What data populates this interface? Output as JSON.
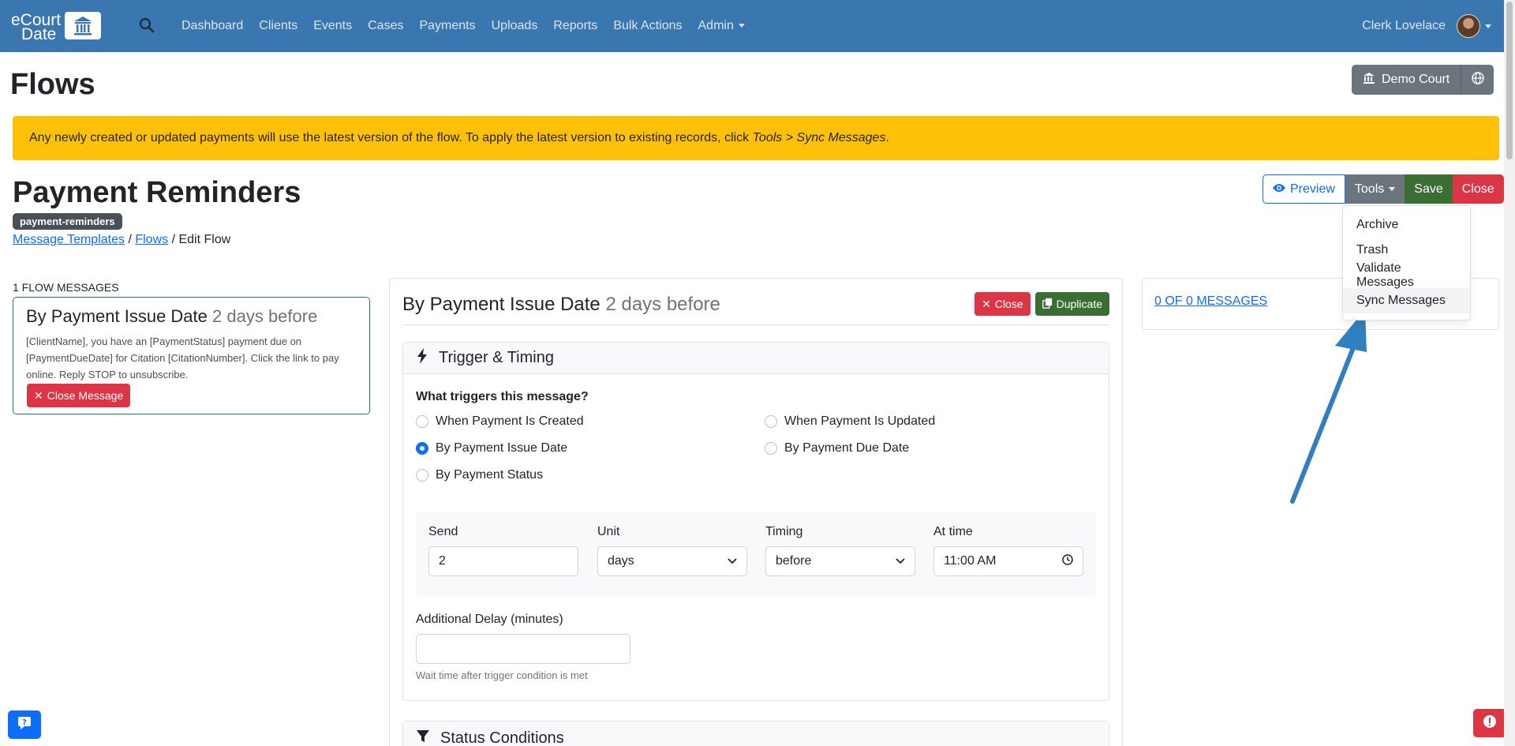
{
  "app": {
    "brand_line1": "eCourt",
    "brand_line2": "Date"
  },
  "nav": {
    "items": [
      "Dashboard",
      "Clients",
      "Events",
      "Cases",
      "Payments",
      "Uploads",
      "Reports",
      "Bulk Actions",
      "Admin"
    ],
    "user_name": "Clerk Lovelace"
  },
  "page": {
    "title": "Flows",
    "court_label": "Demo Court"
  },
  "alert": {
    "text": "Any newly created or updated payments will use the latest version of the flow. To apply the latest version to existing records, click ",
    "emph": "Tools > Sync Messages",
    "end": "."
  },
  "flow": {
    "title": "Payment Reminders",
    "slug": "payment-reminders",
    "breadcrumb": {
      "link1": "Message Templates",
      "sep1": " / ",
      "link2": "Flows",
      "sep2": " / ",
      "current": "Edit Flow"
    }
  },
  "toolbar": {
    "preview": "Preview",
    "tools": "Tools",
    "save": "Save",
    "close": "Close"
  },
  "tools_menu": {
    "items": [
      "Archive",
      "Trash",
      "Validate Messages",
      "Sync Messages"
    ],
    "highlighted": "Sync Messages"
  },
  "messages_list": {
    "count_label": "1 FLOW MESSAGES",
    "card": {
      "title": "By Payment Issue Date",
      "timing": "2 days before",
      "body": "[ClientName], you have an [PaymentStatus] payment due on [PaymentDueDate] for Citation [CitationNumber]. Click the link to pay online. Reply STOP to unsubscribe.",
      "close_label": "Close Message"
    }
  },
  "editor": {
    "title": "By Payment Issue Date",
    "timing": "2 days before",
    "close_label": "Close",
    "duplicate_label": "Duplicate",
    "trigger_section": "Trigger & Timing",
    "trigger_question": "What triggers this message?",
    "trigger_options": [
      "When Payment Is Created",
      "When Payment Is Updated",
      "By Payment Issue Date",
      "By Payment Due Date",
      "By Payment Status"
    ],
    "selected_trigger": "By Payment Issue Date",
    "send_label": "Send",
    "send_value": "2",
    "unit_label": "Unit",
    "unit_value": "days",
    "timing_label": "Timing",
    "timing_value": "before",
    "time_label": "At time",
    "time_value": "11:00 AM",
    "delay_label": "Additional Delay (minutes)",
    "delay_value": "",
    "delay_help": "Wait time after trigger condition is met",
    "status_section": "Status Conditions"
  },
  "right_panel": {
    "messages_link": "0 OF 0 MESSAGES"
  },
  "colors": {
    "navbar": "#3a77b0",
    "alert": "#ffc107",
    "primary": "#0d6efd",
    "danger": "#dc3545",
    "success": "#3b6e35",
    "secondary": "#6c757d",
    "annotation_arrow": "#2f7fc1"
  },
  "icons": {
    "search": "search-icon",
    "court": "bank-icon",
    "globe": "globe-icon",
    "preview": "eye-icon",
    "trigger": "lightning-icon",
    "status": "filter-icon",
    "clock": "clock-icon",
    "chat": "chat-icon",
    "alert": "exclamation-icon"
  }
}
